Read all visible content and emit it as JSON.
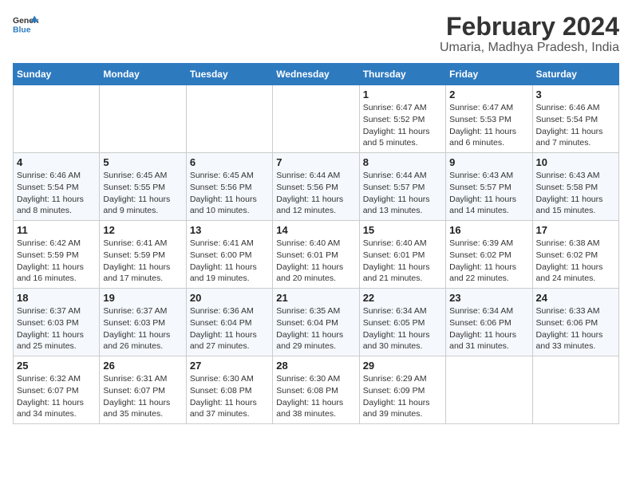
{
  "logo": {
    "line1": "General",
    "line2": "Blue"
  },
  "title": "February 2024",
  "subtitle": "Umaria, Madhya Pradesh, India",
  "days_of_week": [
    "Sunday",
    "Monday",
    "Tuesday",
    "Wednesday",
    "Thursday",
    "Friday",
    "Saturday"
  ],
  "weeks": [
    [
      {
        "num": "",
        "detail": ""
      },
      {
        "num": "",
        "detail": ""
      },
      {
        "num": "",
        "detail": ""
      },
      {
        "num": "",
        "detail": ""
      },
      {
        "num": "1",
        "detail": "Sunrise: 6:47 AM\nSunset: 5:52 PM\nDaylight: 11 hours\nand 5 minutes."
      },
      {
        "num": "2",
        "detail": "Sunrise: 6:47 AM\nSunset: 5:53 PM\nDaylight: 11 hours\nand 6 minutes."
      },
      {
        "num": "3",
        "detail": "Sunrise: 6:46 AM\nSunset: 5:54 PM\nDaylight: 11 hours\nand 7 minutes."
      }
    ],
    [
      {
        "num": "4",
        "detail": "Sunrise: 6:46 AM\nSunset: 5:54 PM\nDaylight: 11 hours\nand 8 minutes."
      },
      {
        "num": "5",
        "detail": "Sunrise: 6:45 AM\nSunset: 5:55 PM\nDaylight: 11 hours\nand 9 minutes."
      },
      {
        "num": "6",
        "detail": "Sunrise: 6:45 AM\nSunset: 5:56 PM\nDaylight: 11 hours\nand 10 minutes."
      },
      {
        "num": "7",
        "detail": "Sunrise: 6:44 AM\nSunset: 5:56 PM\nDaylight: 11 hours\nand 12 minutes."
      },
      {
        "num": "8",
        "detail": "Sunrise: 6:44 AM\nSunset: 5:57 PM\nDaylight: 11 hours\nand 13 minutes."
      },
      {
        "num": "9",
        "detail": "Sunrise: 6:43 AM\nSunset: 5:57 PM\nDaylight: 11 hours\nand 14 minutes."
      },
      {
        "num": "10",
        "detail": "Sunrise: 6:43 AM\nSunset: 5:58 PM\nDaylight: 11 hours\nand 15 minutes."
      }
    ],
    [
      {
        "num": "11",
        "detail": "Sunrise: 6:42 AM\nSunset: 5:59 PM\nDaylight: 11 hours\nand 16 minutes."
      },
      {
        "num": "12",
        "detail": "Sunrise: 6:41 AM\nSunset: 5:59 PM\nDaylight: 11 hours\nand 17 minutes."
      },
      {
        "num": "13",
        "detail": "Sunrise: 6:41 AM\nSunset: 6:00 PM\nDaylight: 11 hours\nand 19 minutes."
      },
      {
        "num": "14",
        "detail": "Sunrise: 6:40 AM\nSunset: 6:01 PM\nDaylight: 11 hours\nand 20 minutes."
      },
      {
        "num": "15",
        "detail": "Sunrise: 6:40 AM\nSunset: 6:01 PM\nDaylight: 11 hours\nand 21 minutes."
      },
      {
        "num": "16",
        "detail": "Sunrise: 6:39 AM\nSunset: 6:02 PM\nDaylight: 11 hours\nand 22 minutes."
      },
      {
        "num": "17",
        "detail": "Sunrise: 6:38 AM\nSunset: 6:02 PM\nDaylight: 11 hours\nand 24 minutes."
      }
    ],
    [
      {
        "num": "18",
        "detail": "Sunrise: 6:37 AM\nSunset: 6:03 PM\nDaylight: 11 hours\nand 25 minutes."
      },
      {
        "num": "19",
        "detail": "Sunrise: 6:37 AM\nSunset: 6:03 PM\nDaylight: 11 hours\nand 26 minutes."
      },
      {
        "num": "20",
        "detail": "Sunrise: 6:36 AM\nSunset: 6:04 PM\nDaylight: 11 hours\nand 27 minutes."
      },
      {
        "num": "21",
        "detail": "Sunrise: 6:35 AM\nSunset: 6:04 PM\nDaylight: 11 hours\nand 29 minutes."
      },
      {
        "num": "22",
        "detail": "Sunrise: 6:34 AM\nSunset: 6:05 PM\nDaylight: 11 hours\nand 30 minutes."
      },
      {
        "num": "23",
        "detail": "Sunrise: 6:34 AM\nSunset: 6:06 PM\nDaylight: 11 hours\nand 31 minutes."
      },
      {
        "num": "24",
        "detail": "Sunrise: 6:33 AM\nSunset: 6:06 PM\nDaylight: 11 hours\nand 33 minutes."
      }
    ],
    [
      {
        "num": "25",
        "detail": "Sunrise: 6:32 AM\nSunset: 6:07 PM\nDaylight: 11 hours\nand 34 minutes."
      },
      {
        "num": "26",
        "detail": "Sunrise: 6:31 AM\nSunset: 6:07 PM\nDaylight: 11 hours\nand 35 minutes."
      },
      {
        "num": "27",
        "detail": "Sunrise: 6:30 AM\nSunset: 6:08 PM\nDaylight: 11 hours\nand 37 minutes."
      },
      {
        "num": "28",
        "detail": "Sunrise: 6:30 AM\nSunset: 6:08 PM\nDaylight: 11 hours\nand 38 minutes."
      },
      {
        "num": "29",
        "detail": "Sunrise: 6:29 AM\nSunset: 6:09 PM\nDaylight: 11 hours\nand 39 minutes."
      },
      {
        "num": "",
        "detail": ""
      },
      {
        "num": "",
        "detail": ""
      }
    ]
  ]
}
